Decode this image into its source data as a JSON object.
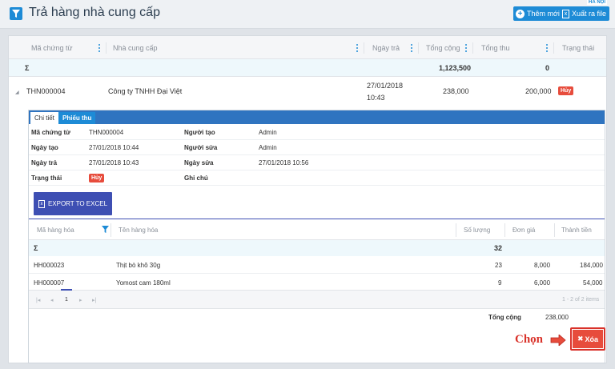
{
  "header": {
    "title": "Trả hàng nhà cung cấp",
    "add_label": "Thêm mới",
    "export_label": "Xuất ra file",
    "badge": "HÀ NỘI"
  },
  "grid": {
    "columns": [
      "Mã chứng từ",
      "Nhà cung cấp",
      "Ngày trả",
      "Tổng cộng",
      "Tổng thu",
      "Trạng thái"
    ],
    "sum_symbol": "Σ",
    "sum_total": "1,123,500",
    "sum_thu": "0",
    "row": {
      "code": "THN000004",
      "supplier": "Công ty TNHH Đại Việt",
      "date": "27/01/2018",
      "time": "10:43",
      "total": "238,000",
      "thu": "200,000",
      "status": "Hủy"
    }
  },
  "detail": {
    "tabs": [
      "Chi tiết",
      "Phiếu thu"
    ],
    "fields": {
      "ma_chung_tu_label": "Mã chứng từ",
      "ma_chung_tu": "THN000004",
      "nguoi_tao_label": "Người tạo",
      "nguoi_tao": "Admin",
      "ngay_tao_label": "Ngày tạo",
      "ngay_tao": "27/01/2018 10:44",
      "nguoi_sua_label": "Người sửa",
      "nguoi_sua": "Admin",
      "ngay_tra_label": "Ngày trả",
      "ngay_tra": "27/01/2018 10:43",
      "ngay_sua_label": "Ngày sửa",
      "ngay_sua": "27/01/2018 10:56",
      "trang_thai_label": "Trạng thái",
      "trang_thai": "Hủy",
      "ghi_chu_label": "Ghi chú"
    },
    "export_excel": "EXPORT TO EXCEL",
    "sub_columns": [
      "Mã hàng hóa",
      "Tên hàng hóa",
      "Số lượng",
      "Đơn giá",
      "Thành tiền"
    ],
    "sub_sum_symbol": "Σ",
    "sub_sum_qty": "32",
    "items": [
      {
        "code": "HH000023",
        "name": "Thịt bò khô 30g",
        "qty": "23",
        "price": "8,000",
        "amount": "184,000"
      },
      {
        "code": "HH000007",
        "name": "Yomost cam 180ml",
        "qty": "9",
        "price": "6,000",
        "amount": "54,000"
      }
    ],
    "pager": {
      "page": "1",
      "info": "1 - 2 of 2 items"
    },
    "total_label": "Tổng cộng",
    "total_value": "238,000",
    "chon_label": "Chọn",
    "delete_label": "Xóa"
  }
}
